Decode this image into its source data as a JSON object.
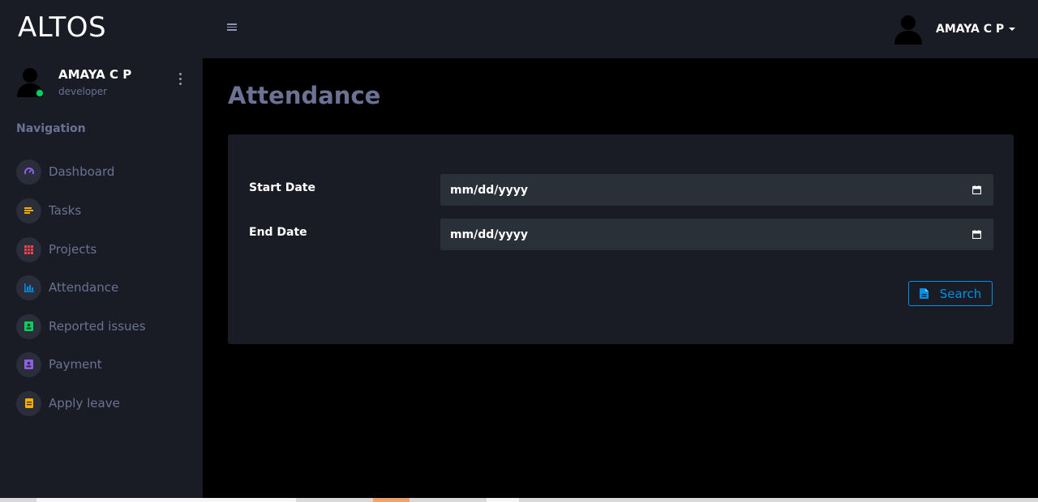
{
  "brand": "ALTOS",
  "profile": {
    "name": "AMAYA C P",
    "role": "developer",
    "status_color": "#00d25b"
  },
  "navigation": {
    "heading": "Navigation",
    "items": [
      {
        "label": "Dashboard",
        "icon": "speedometer-icon",
        "color": "#8f5fe8"
      },
      {
        "label": "Tasks",
        "icon": "tasks-icon",
        "color": "#ffab00"
      },
      {
        "label": "Projects",
        "icon": "table-grid-icon",
        "color": "#fc424a"
      },
      {
        "label": "Attendance",
        "icon": "bar-chart-icon",
        "color": "#0090e7"
      },
      {
        "label": "Reported issues",
        "icon": "contacts-icon",
        "color": "#00d25b"
      },
      {
        "label": "Payment",
        "icon": "contact-card-icon",
        "color": "#8f5fe8"
      },
      {
        "label": "Apply leave",
        "icon": "document-icon",
        "color": "#ffab00"
      }
    ]
  },
  "topbar": {
    "menu_icon": "hamburger-icon",
    "user_name": "AMAYA C P"
  },
  "page": {
    "title": "Attendance"
  },
  "form": {
    "start_date": {
      "label": "Start Date",
      "value": "mm/dd/yyyy"
    },
    "end_date": {
      "label": "End Date",
      "value": "mm/dd/yyyy"
    },
    "search_label": "Search"
  },
  "colors": {
    "sidebar_bg": "#191c24",
    "page_bg": "#000000",
    "muted_text": "#6c7293",
    "accent": "#0090e7",
    "input_bg": "#2a3038"
  }
}
